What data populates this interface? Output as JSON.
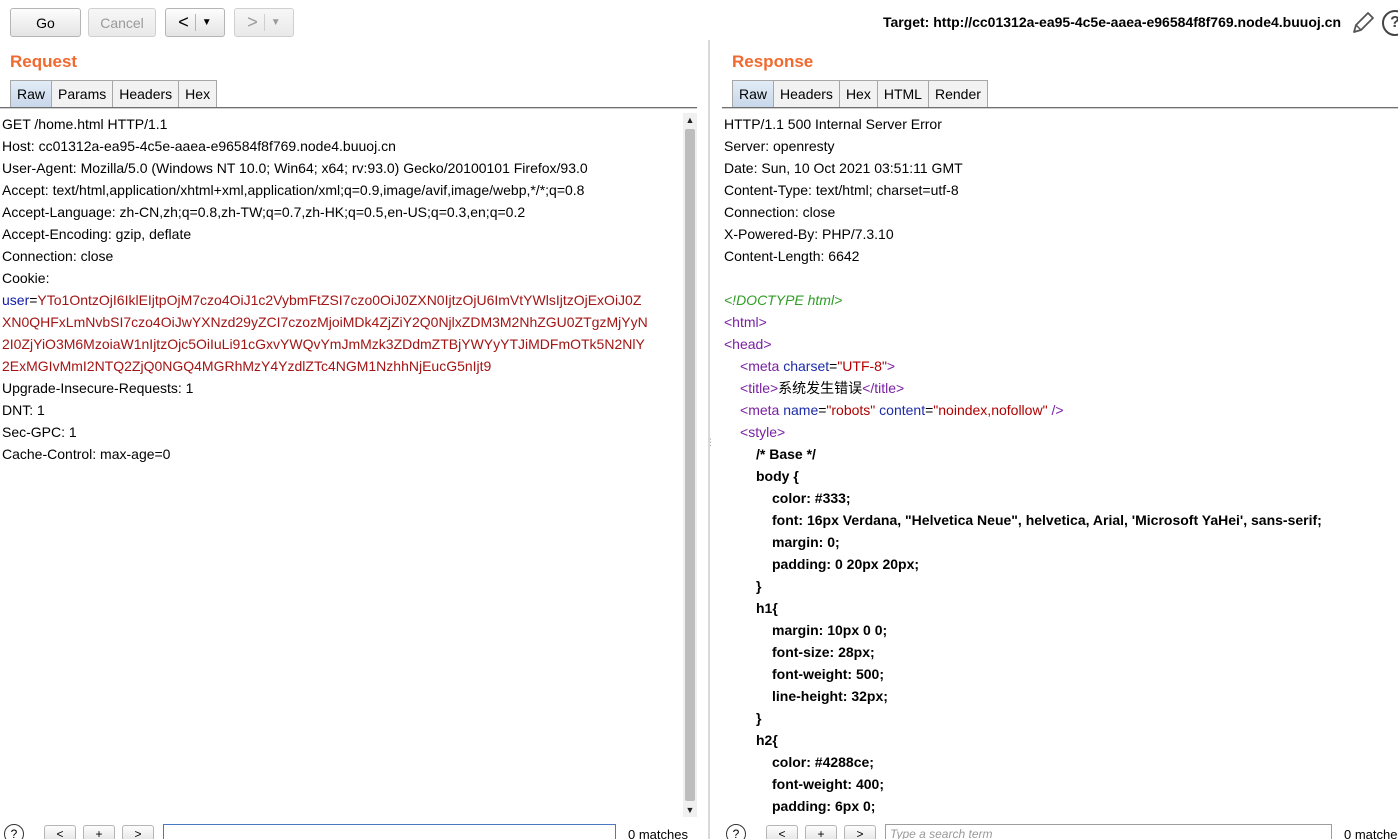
{
  "toolbar": {
    "go_label": "Go",
    "cancel_label": "Cancel",
    "back_label": "<",
    "forward_label": ">",
    "dropdown_arrow": "▼",
    "target_text": "Target: http://cc01312a-ea95-4c5e-aaea-e96584f8f769.node4.buuoj.cn",
    "edit_icon": "pencil-icon",
    "help_icon": "help-icon",
    "help_glyph": "?"
  },
  "request": {
    "title": "Request",
    "tabs": [
      "Raw",
      "Params",
      "Headers",
      "Hex"
    ],
    "active_tab": "Raw",
    "lines": [
      "GET /home.html HTTP/1.1",
      "Host: cc01312a-ea95-4c5e-aaea-e96584f8f769.node4.buuoj.cn",
      "User-Agent: Mozilla/5.0 (Windows NT 10.0; Win64; x64; rv:93.0) Gecko/20100101 Firefox/93.0",
      "Accept: text/html,application/xhtml+xml,application/xml;q=0.9,image/avif,image/webp,*/*;q=0.8",
      "Accept-Language: zh-CN,zh;q=0.8,zh-TW;q=0.7,zh-HK;q=0.5,en-US;q=0.3,en;q=0.2",
      "Accept-Encoding: gzip, deflate",
      "Connection: close",
      "Cookie:"
    ],
    "cookie": {
      "name": "user",
      "eq": "=",
      "value_lines": [
        "YTo1OntzOjI6IklEIjtpOjM7czo4OiJ1c2VybmFtZSI7czo0OiJ0ZXN0IjtzOjU6ImVtYWlsIjtzOjExOiJ0Z",
        "XN0QHFxLmNvbSI7czo4OiJwYXNzd29yZCI7czozMjoiMDk4ZjZiY2Q0NjlxZDM3M2NhZGU0ZTgzMjYyN",
        "2I0ZjYiO3M6MzoiaW1nIjtzOjc5OiIuLi91cGxvYWQvYmJmMzk3ZDdmZTBjYWYyYTJiMDFmOTk5N2NlY",
        "2ExMGIvMmI2NTQ2ZjQ0NGQ4MGRhMzY4YzdlZTc4NGM1NzhhNjEucG5nIjt9"
      ]
    },
    "lines_after": [
      "Upgrade-Insecure-Requests: 1",
      "DNT: 1",
      "Sec-GPC: 1",
      "Cache-Control: max-age=0"
    ]
  },
  "response": {
    "title": "Response",
    "tabs": [
      "Raw",
      "Headers",
      "Hex",
      "HTML",
      "Render"
    ],
    "active_tab": "Raw",
    "header_lines": [
      "HTTP/1.1 500 Internal Server Error",
      "Server: openresty",
      "Date: Sun, 10 Oct 2021 03:51:11 GMT",
      "Content-Type: text/html; charset=utf-8",
      "Connection: close",
      "X-Powered-By: PHP/7.3.10",
      "Content-Length: 6642"
    ],
    "html": {
      "doctype": "<!DOCTYPE html>",
      "html_open": "<html>",
      "head_open": "<head>",
      "meta_tag": "meta",
      "meta_charset_attr": "charset",
      "meta_charset_val": "\"UTF-8\"",
      "title_tag": "title",
      "title_text": "系统发生错误",
      "meta_name_attr": "name",
      "meta_name_val": "\"robots\"",
      "meta_content_attr": "content",
      "meta_content_val": "\"noindex,nofollow\"",
      "style_tag": "style",
      "css_lines": [
        "/* Base */",
        "body {",
        "color: #333;",
        "font: 16px Verdana, \"Helvetica Neue\", helvetica, Arial, 'Microsoft YaHei', sans-serif;",
        "margin: 0;",
        "padding: 0 20px 20px;",
        "}",
        "h1{",
        "margin: 10px 0 0;",
        "font-size: 28px;",
        "font-weight: 500;",
        "line-height: 32px;",
        "}",
        "h2{",
        "color: #4288ce;",
        "font-weight: 400;",
        "padding: 6px 0;"
      ]
    }
  },
  "search": {
    "help_glyph": "?",
    "prev_label": "<",
    "plus_label": "+",
    "next_label": ">",
    "request_value": "",
    "response_placeholder": "Type a search term",
    "matches_text": "0 matches"
  }
}
